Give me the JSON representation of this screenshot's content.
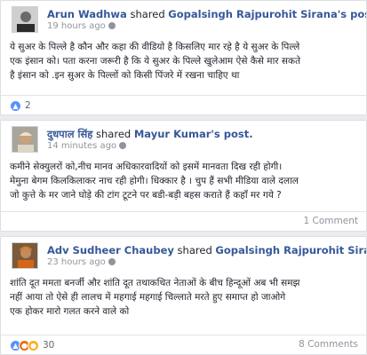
{
  "posts": [
    {
      "author": "Arun Wadhwa",
      "shared_word": " shared ",
      "target": "Gopalsingh Rajpurohit Sirana",
      "suffix": "'s post.",
      "time": "19 hours ago",
      "lines": [
        "ये सुअर के पिल्ले है कौन और कहा की वीडियो है किसलिए मार रहे है ये सुअर के पिल्ले",
        "एक इंसान को। पता करना जरूरी है कि ये सुअर के पिल्ले खुलेआम ऐसे कैसे मार सकते",
        "है इंसान को .इन सुअर के पिल्लों को किसी पिंजरे में रखना चाहिए था"
      ],
      "reactions_count": "2",
      "reactions": [
        "like"
      ],
      "comments_label": ""
    },
    {
      "author": "दुधपाल सिंह",
      "shared_word": " shared ",
      "target": "Mayur Kumar",
      "suffix": "'s post.",
      "time": "14 minutes ago",
      "lines": [
        "कमीने सेक्युलरों को,नीच मानव अधिकारवादियों को इसमें मानवता दिख रही होगी।",
        "मेमुना बेगम किलकिलाकर नाच रही होगी। धिक्कार है । चुप हैं सभी मीडिया वाले दलाल",
        "जो कुत्ते के मर जाने घोड़े की टांग टूटने पर बडी-बड़ी बहस कराते हैं कहाँ मर गये ?"
      ],
      "reactions_count": "",
      "reactions": [],
      "comments_label": "1 Comment"
    },
    {
      "author": "Adv Sudheer Chaubey",
      "shared_word": " shared ",
      "target": "Gopalsingh Rajpurohit Sirana",
      "suffix": "'...",
      "time": "23 hours ago",
      "lines": [
        "शांति दूत ममता बनर्जी और शांति दूत तथाकथित नेताओं के बीच हिन्दूओं अब भी समझ",
        "नहीं आया तो ऐसे ही लालच में महगाई महगाई चिल्लाते मरते हुए समाप्त हो जाओगे",
        "एक होकर मारो गलत करने वाले को"
      ],
      "reactions_count": "30",
      "reactions": [
        "like",
        "angry",
        "haha"
      ],
      "comments_label": "8 Comments"
    }
  ],
  "colors": {
    "link": "#365899",
    "meta": "#90949c",
    "like": "#5890ff",
    "angry": "#e9710f",
    "haha": "#f7b125"
  }
}
